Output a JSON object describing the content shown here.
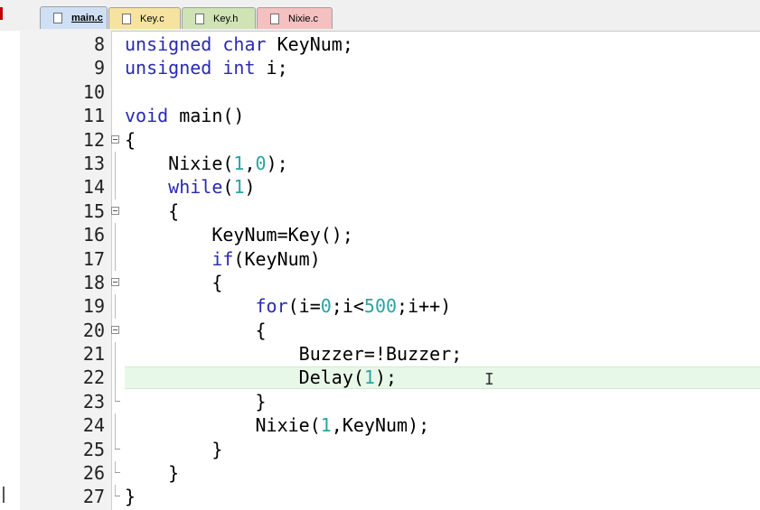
{
  "tabs": [
    {
      "label": "main.c",
      "color": "#cfe0f5",
      "active": true
    },
    {
      "label": "Key.c",
      "color": "#f6e3a0",
      "active": false
    },
    {
      "label": "Key.h",
      "color": "#cfe3b5",
      "active": false
    },
    {
      "label": "Nixie.c",
      "color": "#f4c0c0",
      "active": false
    }
  ],
  "editor": {
    "current_line": 22,
    "lines": [
      {
        "n": "8",
        "fold": "",
        "tokens": [
          [
            "kw",
            "unsigned char"
          ],
          [
            "",
            "KeyNum;"
          ]
        ]
      },
      {
        "n": "9",
        "fold": "",
        "tokens": [
          [
            "kw",
            "unsigned int"
          ],
          [
            "",
            "i;"
          ]
        ]
      },
      {
        "n": "10",
        "fold": "",
        "tokens": []
      },
      {
        "n": "11",
        "fold": "",
        "tokens": [
          [
            "kw",
            "void"
          ],
          [
            "",
            "main()"
          ]
        ]
      },
      {
        "n": "12",
        "fold": "open",
        "tokens": [
          [
            "",
            "{"
          ]
        ]
      },
      {
        "n": "13",
        "fold": "v",
        "tokens": [
          [
            "",
            "    Nixie("
          ],
          [
            "num",
            "1"
          ],
          [
            "",
            ","
          ],
          [
            "num",
            "0"
          ],
          [
            "",
            ");"
          ]
        ]
      },
      {
        "n": "14",
        "fold": "v",
        "tokens": [
          [
            "",
            "    "
          ],
          [
            "kw",
            "while"
          ],
          [
            "",
            "("
          ],
          [
            "num",
            "1"
          ],
          [
            "",
            ")"
          ]
        ]
      },
      {
        "n": "15",
        "fold": "open",
        "tokens": [
          [
            "",
            "    {"
          ]
        ]
      },
      {
        "n": "16",
        "fold": "v",
        "tokens": [
          [
            "",
            "        KeyNum=Key();"
          ]
        ]
      },
      {
        "n": "17",
        "fold": "v",
        "tokens": [
          [
            "",
            "        "
          ],
          [
            "kw",
            "if"
          ],
          [
            "",
            "(KeyNum)"
          ]
        ]
      },
      {
        "n": "18",
        "fold": "open",
        "tokens": [
          [
            "",
            "        {"
          ]
        ]
      },
      {
        "n": "19",
        "fold": "v",
        "tokens": [
          [
            "",
            "            "
          ],
          [
            "kw",
            "for"
          ],
          [
            "",
            "(i="
          ],
          [
            "num",
            "0"
          ],
          [
            "",
            ";i<"
          ],
          [
            "num",
            "500"
          ],
          [
            "",
            ";i++)"
          ]
        ]
      },
      {
        "n": "20",
        "fold": "open",
        "tokens": [
          [
            "",
            "            {"
          ]
        ]
      },
      {
        "n": "21",
        "fold": "v",
        "tokens": [
          [
            "",
            "                Buzzer=!Buzzer;"
          ]
        ]
      },
      {
        "n": "22",
        "fold": "v",
        "tokens": [
          [
            "",
            "                Delay("
          ],
          [
            "num",
            "1"
          ],
          [
            "",
            ");"
          ]
        ]
      },
      {
        "n": "23",
        "fold": "end",
        "tokens": [
          [
            "",
            "            }"
          ]
        ]
      },
      {
        "n": "24",
        "fold": "v",
        "tokens": [
          [
            "",
            "            Nixie("
          ],
          [
            "num",
            "1"
          ],
          [
            "",
            ",KeyNum);"
          ]
        ]
      },
      {
        "n": "25",
        "fold": "end",
        "tokens": [
          [
            "",
            "        }"
          ]
        ]
      },
      {
        "n": "26",
        "fold": "end",
        "tokens": [
          [
            "",
            "    }"
          ]
        ]
      },
      {
        "n": "27",
        "fold": "end",
        "tokens": [
          [
            "",
            "}"
          ]
        ]
      }
    ]
  }
}
